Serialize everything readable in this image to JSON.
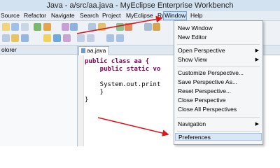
{
  "title": "Java - a/src/aa.java - MyEclipse Enterprise Workbench",
  "menubar": {
    "items": [
      "Source",
      "Refactor",
      "Navigate",
      "Search",
      "Project",
      "MyEclipse",
      "Run",
      "Window",
      "Help"
    ],
    "active": "Window"
  },
  "left_panel": {
    "tab_label": "olorer"
  },
  "editor": {
    "tab_label": "aa.java",
    "lines": [
      "public class aa {",
      "    public static vo",
      "",
      "    System.out.print",
      "    }",
      "}"
    ]
  },
  "window_menu": {
    "items": [
      {
        "label": "New Window",
        "submenu": false
      },
      {
        "label": "New Editor",
        "submenu": false
      },
      {
        "label": "Open Perspective",
        "submenu": true
      },
      {
        "label": "Show View",
        "submenu": true
      },
      {
        "label": "Customize Perspective...",
        "submenu": false
      },
      {
        "label": "Save Perspective As...",
        "submenu": false
      },
      {
        "label": "Reset Perspective...",
        "submenu": false
      },
      {
        "label": "Close Perspective",
        "submenu": false
      },
      {
        "label": "Close All Perspectives",
        "submenu": false
      },
      {
        "label": "Navigation",
        "submenu": true
      },
      {
        "label": "Preferences",
        "submenu": false
      }
    ],
    "highlighted": "Preferences"
  },
  "colors": {
    "annotation_arrow": "#e0141b",
    "menu_highlight": "#d8e6f6"
  }
}
